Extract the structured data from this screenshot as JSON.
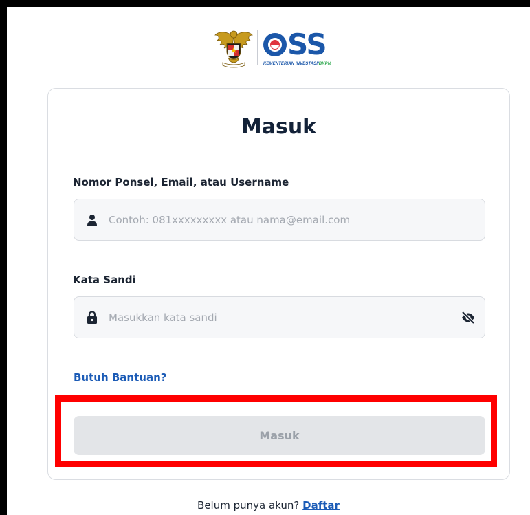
{
  "brand": {
    "name": "OSS",
    "name_rest": "SS",
    "subtitle_main": "KEMENTERIAN INVESTASI/",
    "subtitle_accent": "BKPM",
    "emblem": "garuda-pancasila-emblem",
    "colors": {
      "primary": "#1b57a9",
      "accent_red": "#e0323d",
      "accent_green": "#2ea84e"
    }
  },
  "login": {
    "title": "Masuk",
    "identifier": {
      "label": "Nomor Ponsel, Email, atau Username",
      "placeholder": "Contoh: 081xxxxxxxxx atau nama@email.com",
      "value": "",
      "icon": "user-icon"
    },
    "password": {
      "label": "Kata Sandi",
      "placeholder": "Masukkan kata sandi",
      "value": "",
      "icon": "lock-icon",
      "toggle_icon": "eye-slash-icon"
    },
    "help_link": "Butuh Bantuan?",
    "submit_label": "Masuk",
    "submit_disabled": true,
    "highlight_color": "#ff0000"
  },
  "footer": {
    "prompt": "Belum punya akun?",
    "register_link": "Daftar"
  }
}
